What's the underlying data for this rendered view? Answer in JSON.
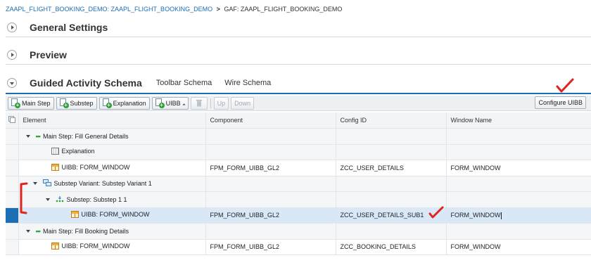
{
  "breadcrumb": {
    "link_text": "ZAAPL_FLIGHT_BOOKING_DEMO: ZAAPL_FLIGHT_BOOKING_DEMO",
    "separator": ">",
    "current": "GAF: ZAAPL_FLIGHT_BOOKING_DEMO"
  },
  "panels": {
    "general_settings": "General Settings",
    "preview": "Preview",
    "guided_activity_schema": "Guided Activity Schema"
  },
  "schema_tabs": [
    "Toolbar Schema",
    "Wire Schema"
  ],
  "toolbar": {
    "main_step": "Main Step",
    "substep": "Substep",
    "explanation": "Explanation",
    "uibb": "UIBB",
    "up": "Up",
    "down": "Down",
    "configure_uibb": "Configure UIBB"
  },
  "table": {
    "columns": [
      "Element",
      "Component",
      "Config ID",
      "Window Name"
    ],
    "rows": [
      {
        "element": "Main Step: Fill General Details",
        "component": "",
        "config_id": "",
        "window": ""
      },
      {
        "element": "Explanation",
        "component": "",
        "config_id": "",
        "window": ""
      },
      {
        "element": "UIBB: FORM_WINDOW",
        "component": "FPM_FORM_UIBB_GL2",
        "config_id": "ZCC_USER_DETAILS",
        "window": "FORM_WINDOW"
      },
      {
        "element": "Substep Variant: Substep Variant 1",
        "component": "",
        "config_id": "",
        "window": ""
      },
      {
        "element": "Substep: Substep 1  1",
        "component": "",
        "config_id": "",
        "window": ""
      },
      {
        "element": "UIBB: FORM_WINDOW",
        "component": "FPM_FORM_UIBB_GL2",
        "config_id": "ZCC_USER_DETAILS_SUB1",
        "window": "FORM_WINDOW"
      },
      {
        "element": "Main Step: Fill Booking Details",
        "component": "",
        "config_id": "",
        "window": ""
      },
      {
        "element": "UIBB: FORM_WINDOW",
        "component": "FPM_FORM_UIBB_GL2",
        "config_id": "ZCC_BOOKING_DETAILS",
        "window": "FORM_WINDOW"
      }
    ]
  },
  "colors": {
    "link": "#1b6eb3",
    "selection": "#1b6eb3",
    "selected_row": "#d9e8f6",
    "annotation": "#e0231f"
  }
}
